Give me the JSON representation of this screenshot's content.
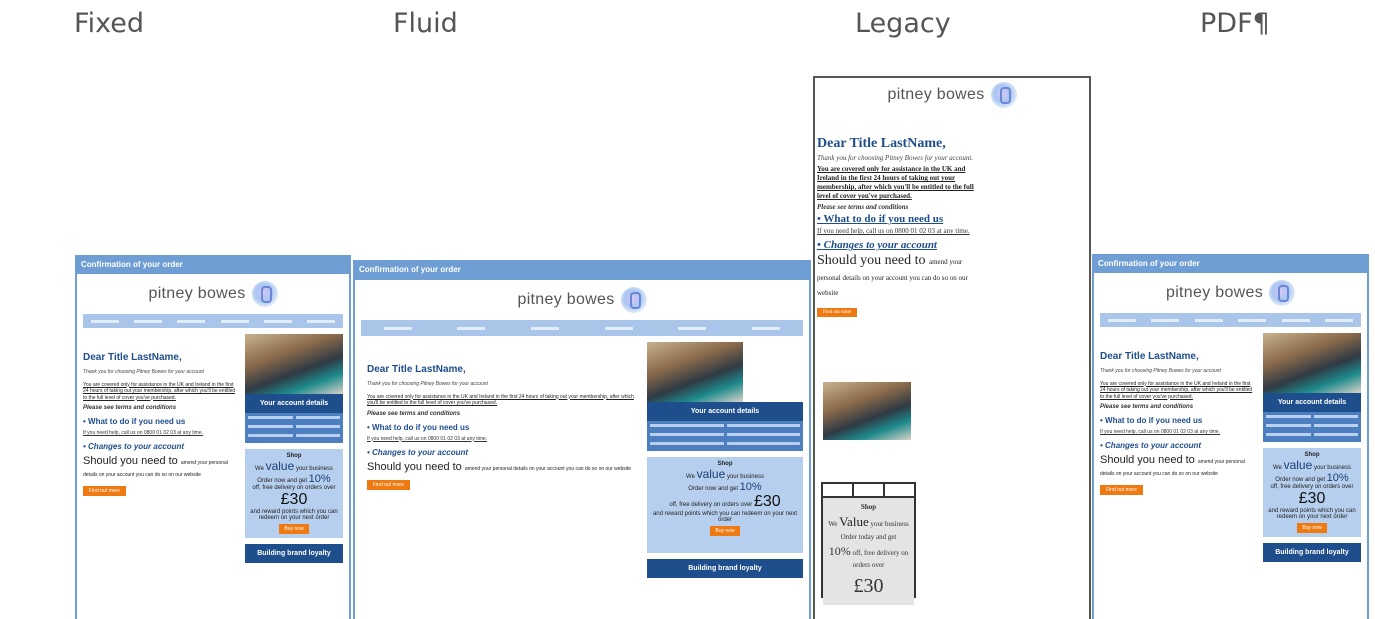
{
  "labels": {
    "fixed": "Fixed",
    "fluid": "Fluid",
    "legacy": "Legacy",
    "pdf": "PDF¶"
  },
  "email": {
    "header_bar": "Confirmation of your order",
    "brand": "pitney bowes",
    "greeting": "Dear Title LastName,",
    "thanks": "Thank you for choosing Pitney Bowes for your account",
    "covered": "You are covered only for assistance in the UK and Ireland in the first 24 hours of taking out your membership, after which you'll be entitled to the full level of cover you've purchased.",
    "terms": "Please see terms and conditions",
    "what_to_do": "What to do if you need us",
    "help": "If you need help, call us on 0800 01 02 03 at any time.",
    "changes": "Changes to your account",
    "should_big": "Should you need to",
    "should_rest": "amend your personal details on your account you can do so on our website",
    "button": "Find out more",
    "account_details": "Your account details",
    "shop": "Shop",
    "we": "We",
    "value": "value",
    "your_business": "your business",
    "order_text": "Order now and get",
    "pct": "10%",
    "off_text": "off, free delivery on orders over",
    "money": "£30",
    "reward_text": "and reward points which you can redeem on your next order",
    "promo_button": "Buy now",
    "loyalty": "Building brand loyalty"
  },
  "legacy": {
    "thanks": "Thank you for choosing Pitney Bowes for your account.",
    "we": "We",
    "value": "Value",
    "your_business": "your business",
    "order_text": "Order today and get",
    "pct": "10%",
    "off_text": "off, free delivery on orders over",
    "money": "£30"
  }
}
